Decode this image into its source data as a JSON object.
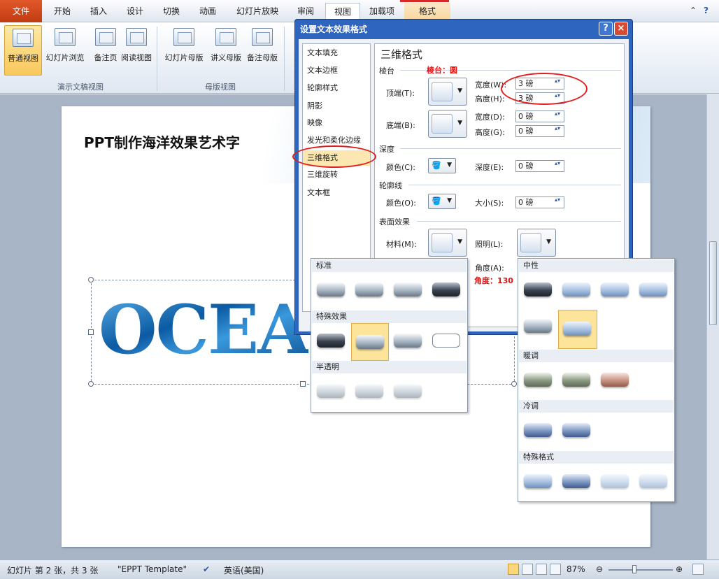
{
  "ribbon_tabs": [
    "文件",
    "开始",
    "插入",
    "设计",
    "切换",
    "动画",
    "幻灯片放映",
    "审阅",
    "视图",
    "加载项",
    "格式"
  ],
  "ribbon": {
    "buttons": [
      "普通视图",
      "幻灯片浏览",
      "备注页",
      "阅读视图",
      "幻灯片母版",
      "讲义母版",
      "备注母版"
    ],
    "group_1": "演示文稿视图",
    "group_2": "母版视图"
  },
  "slide": {
    "title": "PPT制作海洋效果艺术字",
    "art_text": "OCEA"
  },
  "dialog": {
    "title": "设置文本效果格式",
    "help": "?",
    "close": "×",
    "nav": [
      "文本填充",
      "文本边框",
      "轮廓样式",
      "阴影",
      "映像",
      "发光和柔化边缘",
      "三维格式",
      "三维旋转",
      "文本框"
    ],
    "panel_title": "三维格式",
    "bevel_section": "棱台",
    "bevel_note": "棱台：圆",
    "top_label": "顶端(T):",
    "bottom_label": "底端(B):",
    "width_label_top": "宽度(W):",
    "height_label_top": "高度(H):",
    "width_label_bottom": "宽度(D):",
    "height_label_bottom": "高度(G):",
    "top_width": "3 磅",
    "top_height": "3 磅",
    "bottom_width": "0 磅",
    "bottom_height": "0 磅",
    "depth_section": "深度",
    "depth_color_label": "颜色(C):",
    "depth_label": "深度(E):",
    "depth_value": "0 磅",
    "contour_section": "轮廓线",
    "contour_color_label": "颜色(O):",
    "size_label": "大小(S):",
    "size_value": "0 磅",
    "surface_section": "表面效果",
    "material_label": "材料(M):",
    "lighting_label": "照明(L):",
    "angle_label": "角度(A):",
    "angle_note": "角度：130"
  },
  "material_gallery": {
    "standard": "标准",
    "special": "特殊效果",
    "translucent": "半透明"
  },
  "lighting_gallery": {
    "neutral": "中性",
    "warm": "暖调",
    "cool": "冷调",
    "special": "特殊格式"
  },
  "status": {
    "slide": "幻灯片 第 2 张，共 3 张",
    "theme": "\"EPPT Template\"",
    "language": "英语(美国)",
    "zoom": "87%"
  },
  "colors": {
    "accent_file": "#c94a1c",
    "dialog_frame": "#2d65bf",
    "highlight": "#fde49b",
    "annotation": "#e01e1e"
  }
}
